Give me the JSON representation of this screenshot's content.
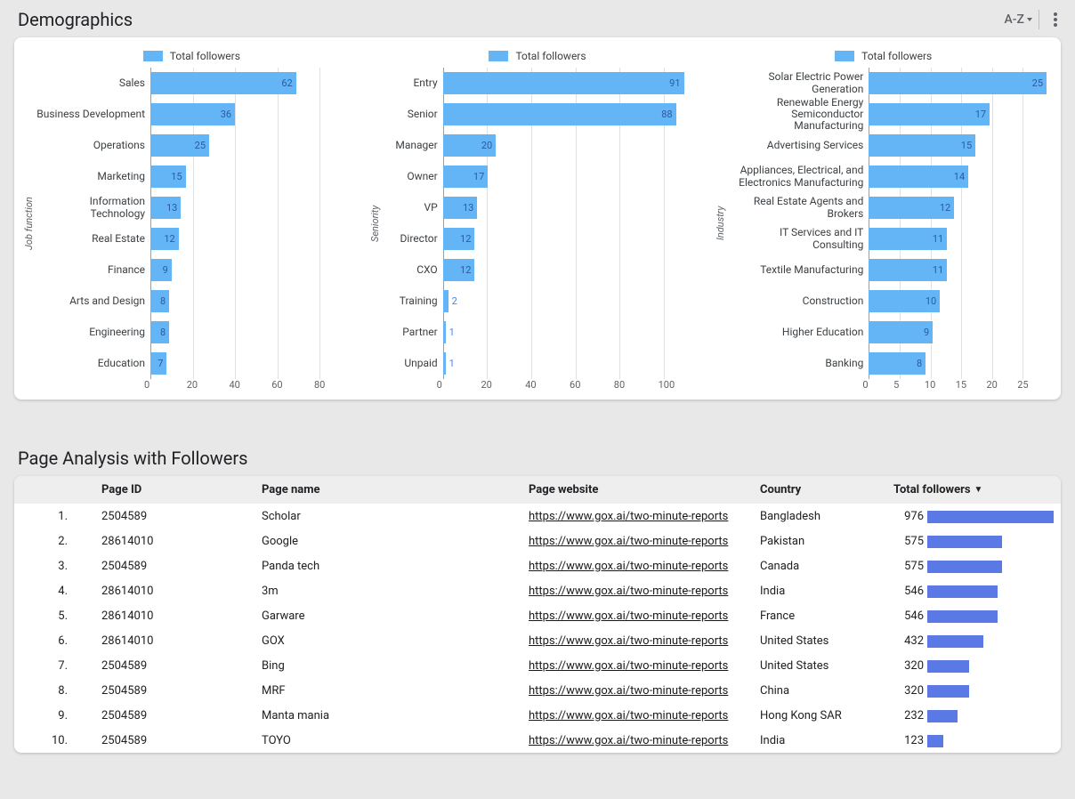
{
  "sections": {
    "demographics_title": "Demographics",
    "page_analysis_title": "Page Analysis with Followers"
  },
  "legend_label": "Total followers",
  "chart_data": [
    {
      "type": "bar",
      "orientation": "horizontal",
      "axis_label": "Job function",
      "legend": "Total followers",
      "categories": [
        "Sales",
        "Business Development",
        "Operations",
        "Marketing",
        "Information Technology",
        "Real Estate",
        "Finance",
        "Arts and Design",
        "Engineering",
        "Education"
      ],
      "values": [
        62,
        36,
        25,
        15,
        13,
        12,
        9,
        8,
        8,
        7
      ],
      "x_ticks": [
        0,
        20,
        40,
        60,
        80
      ],
      "x_max": 90
    },
    {
      "type": "bar",
      "orientation": "horizontal",
      "axis_label": "Seniority",
      "legend": "Total followers",
      "categories": [
        "Entry",
        "Senior",
        "Manager",
        "Owner",
        "VP",
        "Director",
        "CXO",
        "Training",
        "Partner",
        "Unpaid"
      ],
      "values": [
        91,
        88,
        20,
        17,
        13,
        12,
        12,
        2,
        1,
        1
      ],
      "x_ticks": [
        0,
        20,
        40,
        60,
        80,
        100
      ],
      "x_max": 100
    },
    {
      "type": "bar",
      "orientation": "horizontal",
      "axis_label": "Industry",
      "legend": "Total followers",
      "categories": [
        "Solar Electric Power Generation",
        "Renewable Energy Semiconductor Manufacturing",
        "Advertising Services",
        "Appliances, Electrical, and Electronics Manufacturing",
        "Real Estate Agents and Brokers",
        "IT Services and IT Consulting",
        "Textile Manufacturing",
        "Construction",
        "Higher Education",
        "Banking"
      ],
      "values": [
        25,
        17,
        15,
        14,
        12,
        11,
        11,
        10,
        9,
        8
      ],
      "x_ticks": [
        0,
        5,
        10,
        15,
        20,
        25
      ],
      "x_max": 26
    }
  ],
  "table": {
    "headers": {
      "page_id": "Page ID",
      "page_name": "Page name",
      "page_website": "Page website",
      "country": "Country",
      "total_followers": "Total followers"
    },
    "sort_desc_on": "total_followers",
    "max_followers": 976,
    "rows": [
      {
        "idx": "1.",
        "page_id": "2504589",
        "page_name": "Scholar",
        "page_website": "https://www.gox.ai/two-minute-reports",
        "country": "Bangladesh",
        "followers": 976
      },
      {
        "idx": "2.",
        "page_id": "28614010",
        "page_name": "Google",
        "page_website": "https://www.gox.ai/two-minute-reports",
        "country": "Pakistan",
        "followers": 575
      },
      {
        "idx": "3.",
        "page_id": "2504589",
        "page_name": "Panda tech",
        "page_website": "https://www.gox.ai/two-minute-reports",
        "country": "Canada",
        "followers": 575
      },
      {
        "idx": "4.",
        "page_id": "28614010",
        "page_name": "3m",
        "page_website": "https://www.gox.ai/two-minute-reports",
        "country": "India",
        "followers": 546
      },
      {
        "idx": "5.",
        "page_id": "28614010",
        "page_name": "Garware",
        "page_website": "https://www.gox.ai/two-minute-reports",
        "country": "France",
        "followers": 546
      },
      {
        "idx": "6.",
        "page_id": "28614010",
        "page_name": "GOX",
        "page_website": "https://www.gox.ai/two-minute-reports",
        "country": "United States",
        "followers": 432
      },
      {
        "idx": "7.",
        "page_id": "2504589",
        "page_name": "Bing",
        "page_website": "https://www.gox.ai/two-minute-reports",
        "country": "United States",
        "followers": 320
      },
      {
        "idx": "8.",
        "page_id": "2504589",
        "page_name": "MRF",
        "page_website": "https://www.gox.ai/two-minute-reports",
        "country": "China",
        "followers": 320
      },
      {
        "idx": "9.",
        "page_id": "2504589",
        "page_name": "Manta mania",
        "page_website": "https://www.gox.ai/two-minute-reports",
        "country": "Hong Kong SAR",
        "followers": 232
      },
      {
        "idx": "10.",
        "page_id": "2504589",
        "page_name": "TOYO",
        "page_website": "https://www.gox.ai/two-minute-reports",
        "country": "India",
        "followers": 123
      }
    ]
  }
}
